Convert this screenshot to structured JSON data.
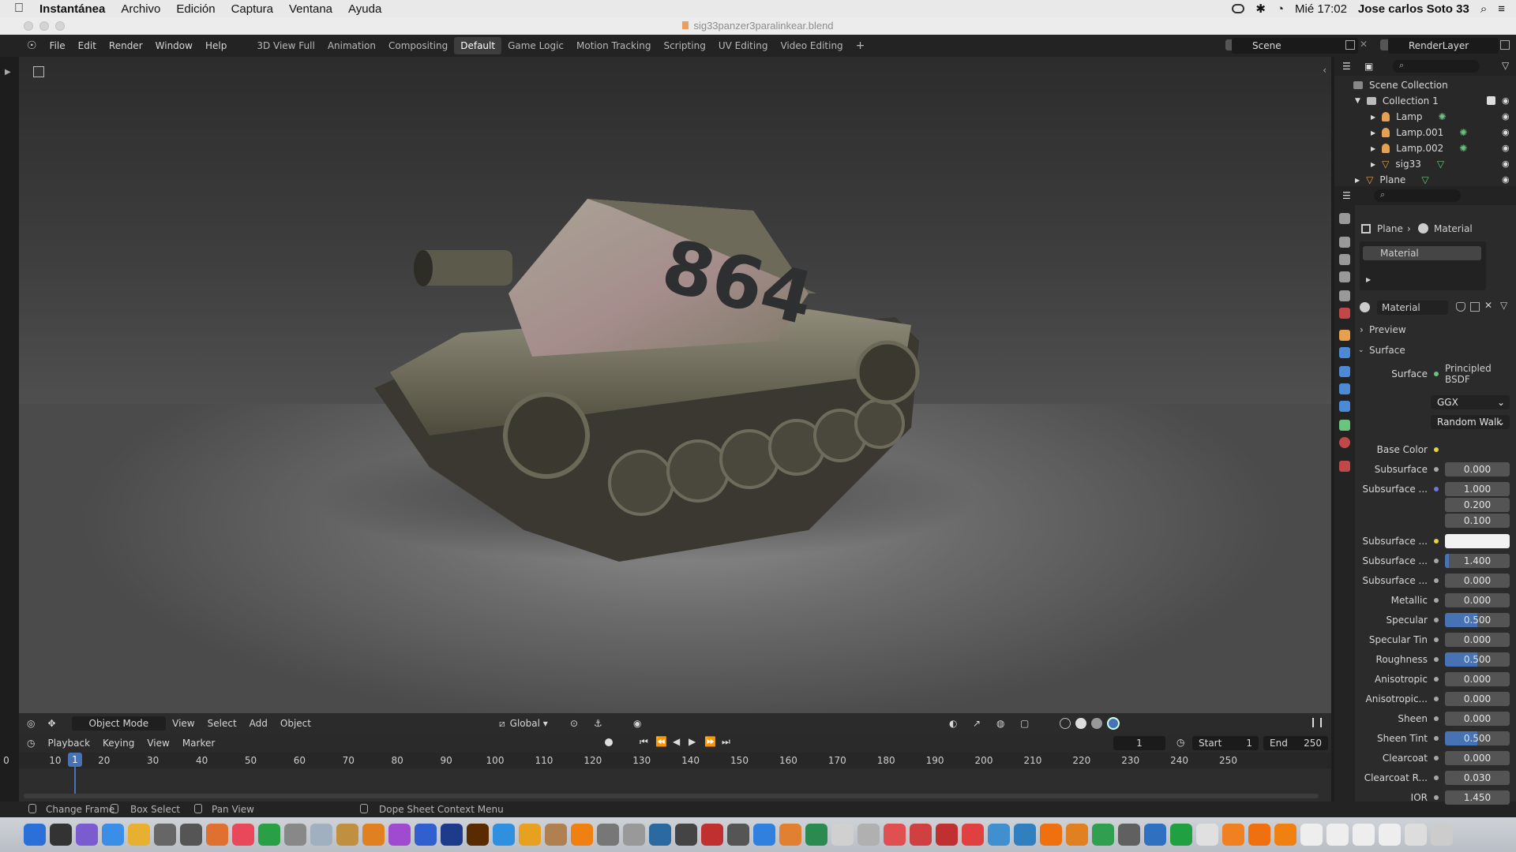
{
  "menubar": {
    "app": "Instantánea",
    "items": [
      "Archivo",
      "Edición",
      "Captura",
      "Ventana",
      "Ayuda"
    ],
    "clock": "Mié 17:02",
    "user": "Jose carlos Soto 33"
  },
  "window": {
    "title": "sig33panzer3paralinkear.blend"
  },
  "topbar": {
    "menus": [
      "File",
      "Edit",
      "Render",
      "Window",
      "Help"
    ],
    "workspaces": [
      "3D View Full",
      "Animation",
      "Compositing",
      "Default",
      "Game Logic",
      "Motion Tracking",
      "Scripting",
      "UV Editing",
      "Video Editing"
    ],
    "active_workspace": "Default",
    "add": "+",
    "scene": "Scene",
    "render_layer": "RenderLayer"
  },
  "viewport_header": {
    "mode": "Object Mode",
    "menus": [
      "View",
      "Select",
      "Add",
      "Object"
    ],
    "orientation": "Global"
  },
  "viewport": {
    "decal_number": "864"
  },
  "timeline": {
    "menus": [
      "Playback",
      "Keying",
      "View",
      "Marker"
    ],
    "current_frame": "1",
    "start_label": "Start",
    "start": "1",
    "end_label": "End",
    "end": "250",
    "ruler": [
      "0",
      "10",
      "20",
      "30",
      "40",
      "50",
      "60",
      "70",
      "80",
      "90",
      "100",
      "110",
      "120",
      "130",
      "140",
      "150",
      "160",
      "170",
      "180",
      "190",
      "200",
      "210",
      "220",
      "230",
      "240",
      "250"
    ]
  },
  "statusbar": {
    "change_frame": "Change Frame",
    "box_select": "Box Select",
    "pan_view": "Pan View",
    "context_menu": "Dope Sheet Context Menu"
  },
  "outliner": {
    "root": "Scene Collection",
    "collection": "Collection 1",
    "items": [
      "Lamp",
      "Lamp.001",
      "Lamp.002",
      "sig33"
    ],
    "plane": "Plane"
  },
  "properties": {
    "breadcrumb_object": "Plane",
    "breadcrumb_tab": "Material",
    "slot": "Material",
    "material_name": "Material",
    "preview": "Preview",
    "surface_panel": "Surface",
    "surface_label": "Surface",
    "surface_value": "Principled BSDF",
    "distribution": "GGX",
    "subsurface_method": "Random Walk",
    "rows": [
      {
        "label": "Base Color",
        "value": ""
      },
      {
        "label": "Subsurface",
        "value": "0.000"
      },
      {
        "label": "Subsurface ...",
        "value": "1.000"
      },
      {
        "label": "",
        "value": "0.200"
      },
      {
        "label": "",
        "value": "0.100"
      },
      {
        "label": "Subsurface ...",
        "value": ""
      },
      {
        "label": "Subsurface ...",
        "value": "1.400"
      },
      {
        "label": "Subsurface ...",
        "value": "0.000"
      },
      {
        "label": "Metallic",
        "value": "0.000"
      },
      {
        "label": "Specular",
        "value": "0.500"
      },
      {
        "label": "Specular Tin",
        "value": "0.000"
      },
      {
        "label": "Roughness",
        "value": "0.500"
      },
      {
        "label": "Anisotropic",
        "value": "0.000"
      },
      {
        "label": "Anisotropic...",
        "value": "0.000"
      },
      {
        "label": "Sheen",
        "value": "0.000"
      },
      {
        "label": "Sheen Tint",
        "value": "0.500"
      },
      {
        "label": "Clearcoat",
        "value": "0.000"
      },
      {
        "label": "Clearcoat R...",
        "value": "0.030"
      },
      {
        "label": "IOR",
        "value": "1.450"
      }
    ]
  },
  "colors": {
    "accent": "#4772b3",
    "panel": "#2b2b2b",
    "lamp_icon": "#e7a050",
    "mesh_icon": "#6ac47e"
  }
}
